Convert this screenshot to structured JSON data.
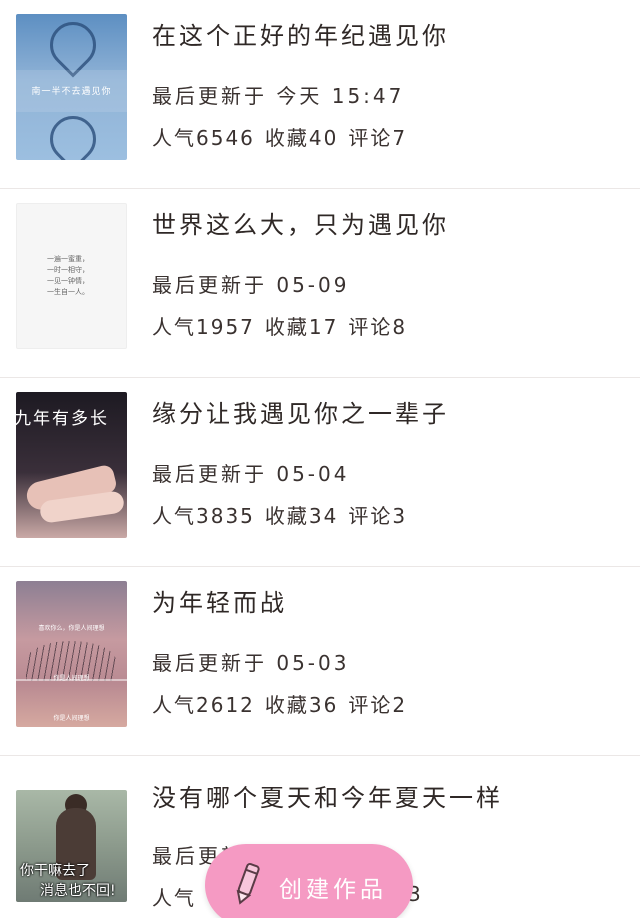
{
  "items": [
    {
      "title": "在这个正好的年纪遇见你",
      "updated": "最后更新于 今天 15:47",
      "popularity": "人气6546",
      "favorites": "收藏40",
      "comments": "评论7",
      "thumb_caption": "南一半不去遇见你"
    },
    {
      "title": "世界这么大，只为遇见你",
      "updated": "最后更新于 05-09",
      "popularity": "人气1957",
      "favorites": "收藏17",
      "comments": "评论8",
      "thumb_caption": "一遍一蜜重，\n一时一相守，\n一见一钟情，\n一生自一人。"
    },
    {
      "title": "缘分让我遇见你之一辈子",
      "updated": "最后更新于 05-04",
      "popularity": "人气3835",
      "favorites": "收藏34",
      "comments": "评论3",
      "thumb_caption": "九年有多长"
    },
    {
      "title": "为年轻而战",
      "updated": "最后更新于 05-03",
      "popularity": "人气2612",
      "favorites": "收藏36",
      "comments": "评论2",
      "thumb_caption_top": "喜欢你么，你是人间理想",
      "thumb_caption_mid": "你是人间理想",
      "thumb_caption_bottom": "你是人间理想"
    },
    {
      "title": "没有哪个夏天和今年夏天一样",
      "updated": "最后更新于",
      "popularity": "人气",
      "favorites": "",
      "comments": "3",
      "thumb_caption_1": "你干嘛去了",
      "thumb_caption_2": "消息也不回!"
    }
  ],
  "fab": {
    "label": "创建作品",
    "icon": "pencil-icon",
    "color": "#f59ac3"
  }
}
